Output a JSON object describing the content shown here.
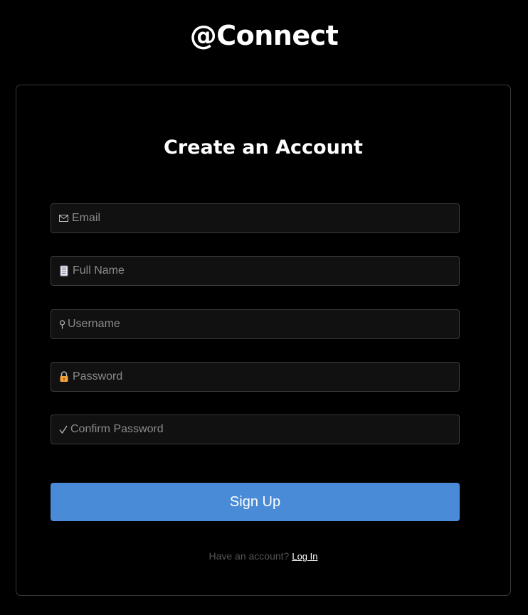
{
  "app": {
    "title": "@Connect"
  },
  "form": {
    "heading": "Create an Account",
    "fields": [
      {
        "name": "email",
        "icon": "mail-icon",
        "placeholder": "Email",
        "value": ""
      },
      {
        "name": "full_name",
        "icon": "scroll-icon",
        "placeholder": "Full Name",
        "value": ""
      },
      {
        "name": "username",
        "icon": "pin-icon",
        "placeholder": "Username",
        "value": ""
      },
      {
        "name": "password",
        "icon": "lock-icon",
        "placeholder": "Password",
        "value": ""
      },
      {
        "name": "confirm_password",
        "icon": "checkmark-icon",
        "placeholder": "Confirm Password",
        "value": ""
      }
    ],
    "submit_label": "Sign Up",
    "footer_prompt": "Have an account?",
    "footer_link": "Log In"
  },
  "colors": {
    "background": "#000000",
    "button": "#4a8bd8",
    "field_bg": "#111111",
    "border": "#3b3b3b"
  }
}
